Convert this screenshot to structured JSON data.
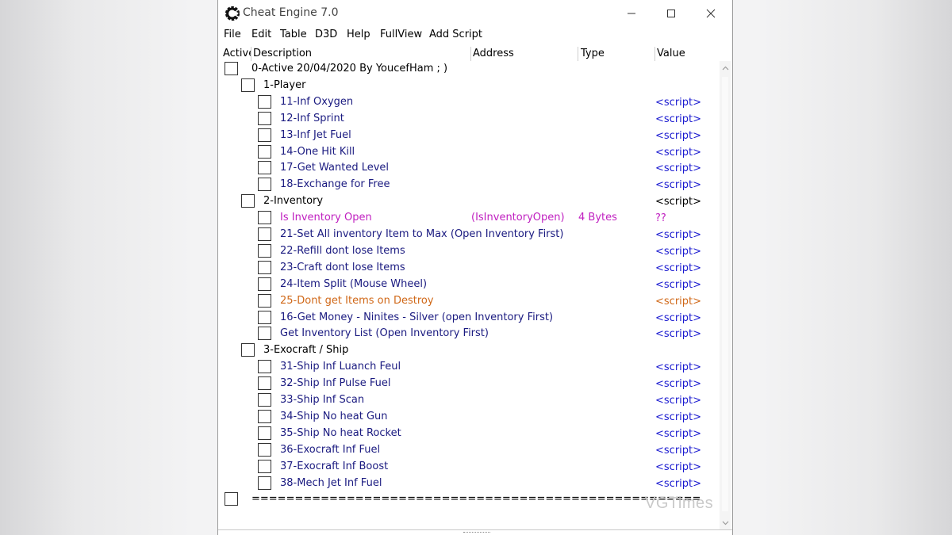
{
  "window": {
    "title": "Cheat Engine 7.0",
    "icon": "cheat-engine-logo-icon"
  },
  "menu": [
    "File",
    "Edit",
    "Table",
    "D3D",
    "Help",
    "FullView",
    "Add Script"
  ],
  "columns": {
    "active": "Active",
    "description": "Description",
    "address": "Address",
    "type": "Type",
    "value": "Value"
  },
  "rows": [
    {
      "level": 0,
      "description": "0-Active 20/04/2020 By YoucefHam ; )",
      "address": "",
      "type": "",
      "value": "",
      "color": "black"
    },
    {
      "level": 1,
      "description": "1-Player",
      "address": "",
      "type": "",
      "value": "",
      "color": "black"
    },
    {
      "level": 2,
      "description": "11-Inf Oxygen",
      "address": "",
      "type": "",
      "value": "<script>",
      "color": "navy"
    },
    {
      "level": 2,
      "description": "12-Inf Sprint",
      "address": "",
      "type": "",
      "value": "<script>",
      "color": "navy"
    },
    {
      "level": 2,
      "description": "13-Inf Jet Fuel",
      "address": "",
      "type": "",
      "value": "<script>",
      "color": "navy"
    },
    {
      "level": 2,
      "description": "14-One Hit Kill",
      "address": "",
      "type": "",
      "value": "<script>",
      "color": "navy"
    },
    {
      "level": 2,
      "description": "17-Get Wanted Level",
      "address": "",
      "type": "",
      "value": "<script>",
      "color": "navy"
    },
    {
      "level": 2,
      "description": "18-Exchange for Free",
      "address": "",
      "type": "",
      "value": "<script>",
      "color": "navy"
    },
    {
      "level": 1,
      "description": "2-Inventory",
      "address": "",
      "type": "",
      "value": "<script>",
      "color": "black"
    },
    {
      "level": 2,
      "description": "Is Inventory Open",
      "address": "(IsInventoryOpen)",
      "type": "4 Bytes",
      "value": "??",
      "color": "magenta"
    },
    {
      "level": 2,
      "description": "21-Set All inventory Item to Max (Open Inventory First)",
      "address": "",
      "type": "",
      "value": "<script>",
      "color": "navy"
    },
    {
      "level": 2,
      "description": "22-Refill dont lose Items",
      "address": "",
      "type": "",
      "value": "<script>",
      "color": "navy"
    },
    {
      "level": 2,
      "description": "23-Craft dont lose Items",
      "address": "",
      "type": "",
      "value": "<script>",
      "color": "navy"
    },
    {
      "level": 2,
      "description": "24-Item Split (Mouse Wheel)",
      "address": "",
      "type": "",
      "value": "<script>",
      "color": "navy"
    },
    {
      "level": 2,
      "description": "25-Dont get Items on Destroy",
      "address": "",
      "type": "",
      "value": "<script>",
      "color": "orange"
    },
    {
      "level": 2,
      "description": "16-Get Money - Ninites - Silver (open Inventory First)",
      "address": "",
      "type": "",
      "value": "<script>",
      "color": "navy"
    },
    {
      "level": 2,
      "description": "Get Inventory List (Open Inventory First)",
      "address": "",
      "type": "",
      "value": "<script>",
      "color": "navy"
    },
    {
      "level": 1,
      "description": "3-Exocraft / Ship",
      "address": "",
      "type": "",
      "value": "",
      "color": "black"
    },
    {
      "level": 2,
      "description": "31-Ship Inf Luanch Feul",
      "address": "",
      "type": "",
      "value": "<script>",
      "color": "navy"
    },
    {
      "level": 2,
      "description": "32-Ship Inf Pulse Fuel",
      "address": "",
      "type": "",
      "value": "<script>",
      "color": "navy"
    },
    {
      "level": 2,
      "description": "33-Ship Inf Scan",
      "address": "",
      "type": "",
      "value": "<script>",
      "color": "navy"
    },
    {
      "level": 2,
      "description": "34-Ship No heat Gun",
      "address": "",
      "type": "",
      "value": "<script>",
      "color": "navy"
    },
    {
      "level": 2,
      "description": "35-Ship No heat Rocket",
      "address": "",
      "type": "",
      "value": "<script>",
      "color": "navy"
    },
    {
      "level": 2,
      "description": "36-Exocraft Inf Fuel",
      "address": "",
      "type": "",
      "value": "<script>",
      "color": "navy"
    },
    {
      "level": 2,
      "description": "37-Exocraft Inf Boost",
      "address": "",
      "type": "",
      "value": "<script>",
      "color": "navy"
    },
    {
      "level": 2,
      "description": "38-Mech Jet Inf Fuel",
      "address": "",
      "type": "",
      "value": "<script>",
      "color": "navy"
    },
    {
      "level": 0,
      "description": "====================================================",
      "address": "",
      "type": "",
      "value": "",
      "color": "black"
    }
  ],
  "colors": {
    "black": "#000000",
    "navy": "#1a1a80",
    "script_value": "#1a1ad0",
    "magenta": "#c020c0",
    "orange": "#d06818"
  },
  "watermark": "VGTimes"
}
